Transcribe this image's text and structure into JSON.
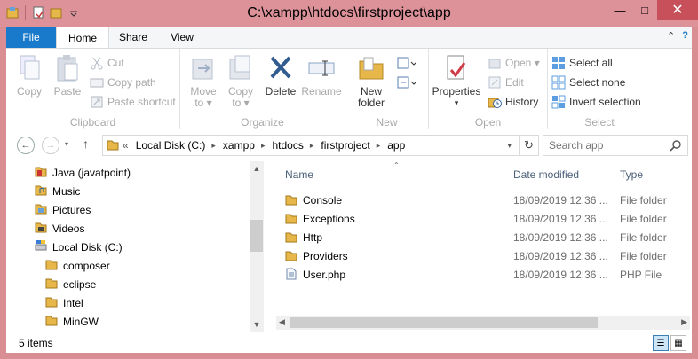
{
  "window": {
    "title": "C:\\xampp\\htdocs\\firstproject\\app"
  },
  "tabs": {
    "file": "File",
    "home": "Home",
    "share": "Share",
    "view": "View"
  },
  "ribbon": {
    "clipboard": {
      "label": "Clipboard",
      "copy": "Copy",
      "paste": "Paste",
      "cut": "Cut",
      "copy_path": "Copy path",
      "paste_shortcut": "Paste shortcut"
    },
    "organize": {
      "label": "Organize",
      "move_to_1": "Move",
      "move_to_2": "to ▾",
      "copy_to_1": "Copy",
      "copy_to_2": "to ▾",
      "delete": "Delete",
      "rename": "Rename"
    },
    "new": {
      "label": "New",
      "new_folder_1": "New",
      "new_folder_2": "folder"
    },
    "open": {
      "label": "Open",
      "properties": "Properties",
      "open": "Open ▾",
      "edit": "Edit",
      "history": "History"
    },
    "select": {
      "label": "Select",
      "select_all": "Select all",
      "select_none": "Select none",
      "invert_selection": "Invert selection"
    }
  },
  "address": {
    "prefix": "«",
    "crumbs": [
      "Local Disk (C:)",
      "xampp",
      "htdocs",
      "firstproject",
      "app"
    ],
    "search_placeholder": "Search app"
  },
  "nav_pane": {
    "items": [
      {
        "label": "Java (javatpoint)",
        "icon": "java-folder-icon"
      },
      {
        "label": "Music",
        "icon": "music-folder-icon"
      },
      {
        "label": "Pictures",
        "icon": "pictures-folder-icon"
      },
      {
        "label": "Videos",
        "icon": "videos-folder-icon"
      },
      {
        "label": "Local Disk (C:)",
        "icon": "drive-icon"
      },
      {
        "label": "composer",
        "icon": "folder-icon"
      },
      {
        "label": "eclipse",
        "icon": "folder-icon"
      },
      {
        "label": "Intel",
        "icon": "folder-icon"
      },
      {
        "label": "MinGW",
        "icon": "folder-icon"
      }
    ]
  },
  "files": {
    "columns": {
      "name": "Name",
      "date": "Date modified",
      "type": "Type"
    },
    "rows": [
      {
        "name": "Console",
        "date": "18/09/2019 12:36 ...",
        "type": "File folder",
        "icon": "folder-icon"
      },
      {
        "name": "Exceptions",
        "date": "18/09/2019 12:36 ...",
        "type": "File folder",
        "icon": "folder-icon"
      },
      {
        "name": "Http",
        "date": "18/09/2019 12:36 ...",
        "type": "File folder",
        "icon": "folder-icon"
      },
      {
        "name": "Providers",
        "date": "18/09/2019 12:36 ...",
        "type": "File folder",
        "icon": "folder-icon"
      },
      {
        "name": "User.php",
        "date": "18/09/2019 12:36 ...",
        "type": "PHP File",
        "icon": "php-file-icon"
      }
    ]
  },
  "status": {
    "items_count": "5 items"
  },
  "colors": {
    "frame": "#dc9298",
    "file_tab": "#1979ca",
    "close_button": "#c7505a",
    "folder": "#e8b74a"
  }
}
